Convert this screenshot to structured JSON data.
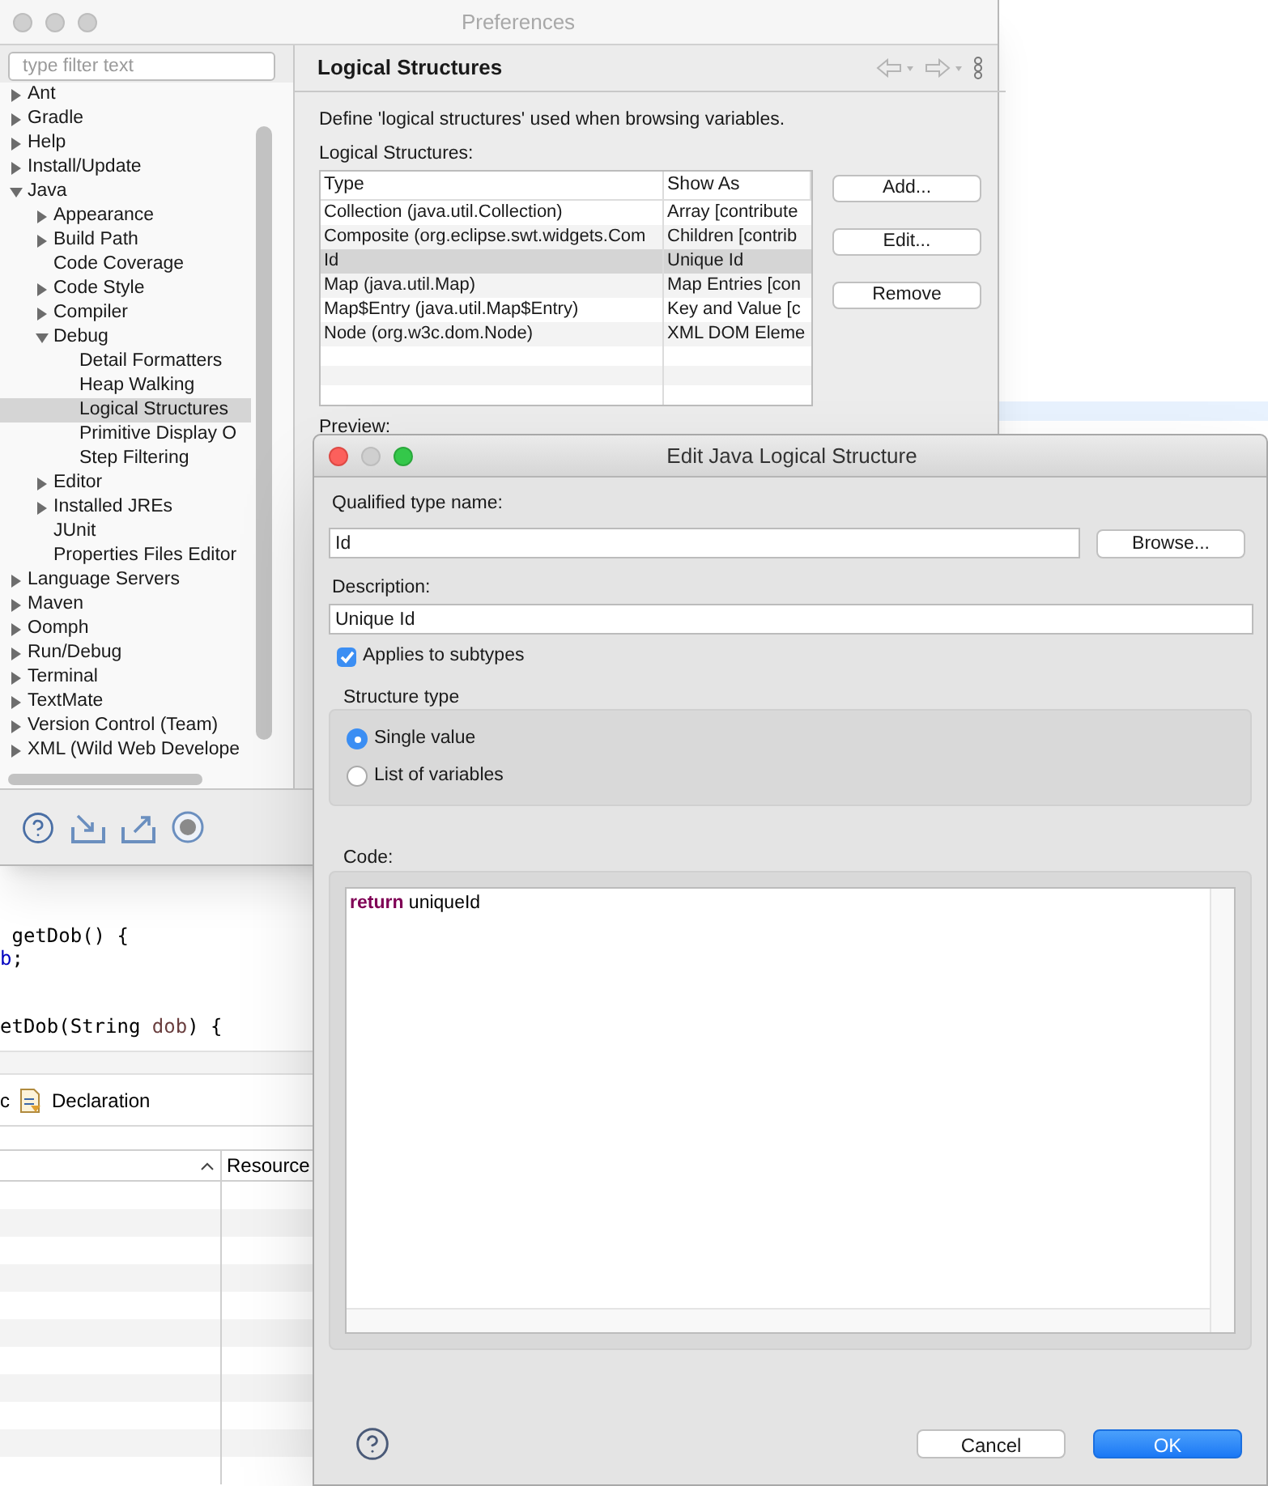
{
  "editor": {
    "code_lines": [
      {
        "kind": "code",
        "segments": [
          {
            "text": " getDob() {",
            "kind": "plain"
          }
        ]
      },
      {
        "kind": "code",
        "segments": [
          {
            "text": "b",
            "kind": "field"
          },
          {
            "text": ";",
            "kind": "plain"
          }
        ]
      },
      {
        "kind": "blank"
      },
      {
        "kind": "blank"
      },
      {
        "kind": "code",
        "segments": [
          {
            "text": "etDob(String ",
            "kind": "plain"
          },
          {
            "text": "dob",
            "kind": "param"
          },
          {
            "text": ") {",
            "kind": "plain"
          }
        ]
      }
    ],
    "tabs": [
      {
        "label": "c"
      },
      {
        "label": "Declaration"
      }
    ],
    "table": {
      "columns": [
        {
          "label": "Resource"
        }
      ]
    }
  },
  "preferences": {
    "title": "Preferences",
    "active": false,
    "filter": {
      "placeholder": "type filter text"
    },
    "tree": [
      {
        "label": "Ant",
        "expanded": false,
        "selected": false
      },
      {
        "label": "Gradle",
        "expanded": false,
        "selected": false
      },
      {
        "label": "Help",
        "expanded": false,
        "selected": false
      },
      {
        "label": "Install/Update",
        "expanded": false,
        "selected": false
      },
      {
        "label": "Java",
        "expanded": true,
        "selected": false,
        "children": [
          {
            "label": "Appearance",
            "expanded": false,
            "selected": false
          },
          {
            "label": "Build Path",
            "expanded": false,
            "selected": false
          },
          {
            "label": "Code Coverage",
            "selected": false
          },
          {
            "label": "Code Style",
            "expanded": false,
            "selected": false
          },
          {
            "label": "Compiler",
            "expanded": false,
            "selected": false
          },
          {
            "label": "Debug",
            "expanded": true,
            "selected": false,
            "children": [
              {
                "label": "Detail Formatters",
                "selected": false
              },
              {
                "label": "Heap Walking",
                "selected": false
              },
              {
                "label": "Logical Structures",
                "selected": true
              },
              {
                "label": "Primitive Display O",
                "selected": false
              },
              {
                "label": "Step Filtering",
                "selected": false
              }
            ]
          },
          {
            "label": "Editor",
            "expanded": false,
            "selected": false
          },
          {
            "label": "Installed JREs",
            "expanded": false,
            "selected": false
          },
          {
            "label": "JUnit",
            "selected": false
          },
          {
            "label": "Properties Files Editor",
            "selected": false
          }
        ]
      },
      {
        "label": "Language Servers",
        "expanded": false,
        "selected": false
      },
      {
        "label": "Maven",
        "expanded": false,
        "selected": false
      },
      {
        "label": "Oomph",
        "expanded": false,
        "selected": false
      },
      {
        "label": "Run/Debug",
        "expanded": false,
        "selected": false
      },
      {
        "label": "Terminal",
        "expanded": false,
        "selected": false
      },
      {
        "label": "TextMate",
        "expanded": false,
        "selected": false
      },
      {
        "label": "Version Control (Team)",
        "expanded": false,
        "selected": false
      },
      {
        "label": "XML (Wild Web Develope",
        "expanded": false,
        "selected": false
      }
    ],
    "page": {
      "title": "Logical Structures",
      "description": "Define 'logical structures' used when browsing variables.",
      "list_label": "Logical Structures:",
      "table": {
        "columns": [
          "Type",
          "Show As"
        ],
        "rows": [
          {
            "cells": [
              "Collection (java.util.Collection)",
              "Array [contribute"
            ],
            "selected": false
          },
          {
            "cells": [
              "Composite (org.eclipse.swt.widgets.Com",
              "Children [contrib"
            ],
            "selected": false
          },
          {
            "cells": [
              "Id",
              "Unique Id"
            ],
            "selected": true
          },
          {
            "cells": [
              "Map (java.util.Map)",
              "Map Entries [con"
            ],
            "selected": false
          },
          {
            "cells": [
              "Map$Entry (java.util.Map$Entry)",
              "Key and Value [c"
            ],
            "selected": false
          },
          {
            "cells": [
              "Node (org.w3c.dom.Node)",
              "XML DOM Eleme"
            ],
            "selected": false
          }
        ]
      },
      "buttons": [
        "Add...",
        "Edit...",
        "Remove"
      ],
      "preview_label": "Preview:"
    }
  },
  "dialog": {
    "title": "Edit Java Logical Structure",
    "active": true,
    "type_label": "Qualified type name:",
    "type_value": "Id",
    "browse": "Browse...",
    "description_label": "Description:",
    "description_value": "Unique Id",
    "subtypes": {
      "label": "Applies to subtypes",
      "checked": true
    },
    "structure_type": {
      "label": "Structure type",
      "options": [
        {
          "label": "Single value",
          "selected": true
        },
        {
          "label": "List of variables",
          "selected": false
        }
      ]
    },
    "code_label": "Code:",
    "code": [
      {
        "text": "return",
        "kind": "keyword"
      },
      {
        "text": " uniqueId",
        "kind": "plain"
      }
    ],
    "buttons": [
      {
        "label": "Cancel",
        "kind": "default"
      },
      {
        "label": "OK",
        "kind": "primary"
      }
    ]
  }
}
